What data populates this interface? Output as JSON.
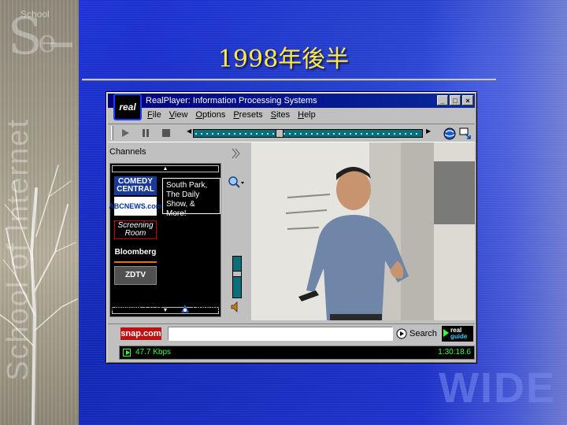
{
  "slide": {
    "title": "1998年後半",
    "side_text": "School of Internet",
    "watermark": "WIDE",
    "logo_text": "School"
  },
  "player": {
    "window_title": "RealPlayer: Information Processing Systems",
    "logo_text": "real",
    "window_buttons": {
      "minimize": "_",
      "maximize": "□",
      "close": "×"
    },
    "menu": [
      "File",
      "View",
      "Options",
      "Presets",
      "Sites",
      "Help"
    ],
    "seek_position": 0.37,
    "volume_level": 0.6,
    "channels": {
      "label": "Channels",
      "items": [
        {
          "name": "COMEDY CENTRAL"
        },
        {
          "name": "ABCNEWS.com"
        },
        {
          "name": "Screening Room"
        },
        {
          "name": "Bloomberg"
        },
        {
          "name": "ZDTV"
        }
      ],
      "tooltip": "South Park, The Daily Show, & More!",
      "updated": "Updated 17:34",
      "update_label": "Update"
    },
    "search": {
      "logo": "snap.com",
      "value": "",
      "button_label": "Search",
      "guide_logo_top": "real",
      "guide_logo_bottom": "guide"
    },
    "status": {
      "bitrate": "47.7 Kbps",
      "time": "1:30:18.6"
    }
  },
  "colors": {
    "slide_background": "#1830c8",
    "title_color": "#ffea40",
    "titlebar": "#000080",
    "status_text": "#2fff3f",
    "seek_track": "#0c6e78"
  }
}
